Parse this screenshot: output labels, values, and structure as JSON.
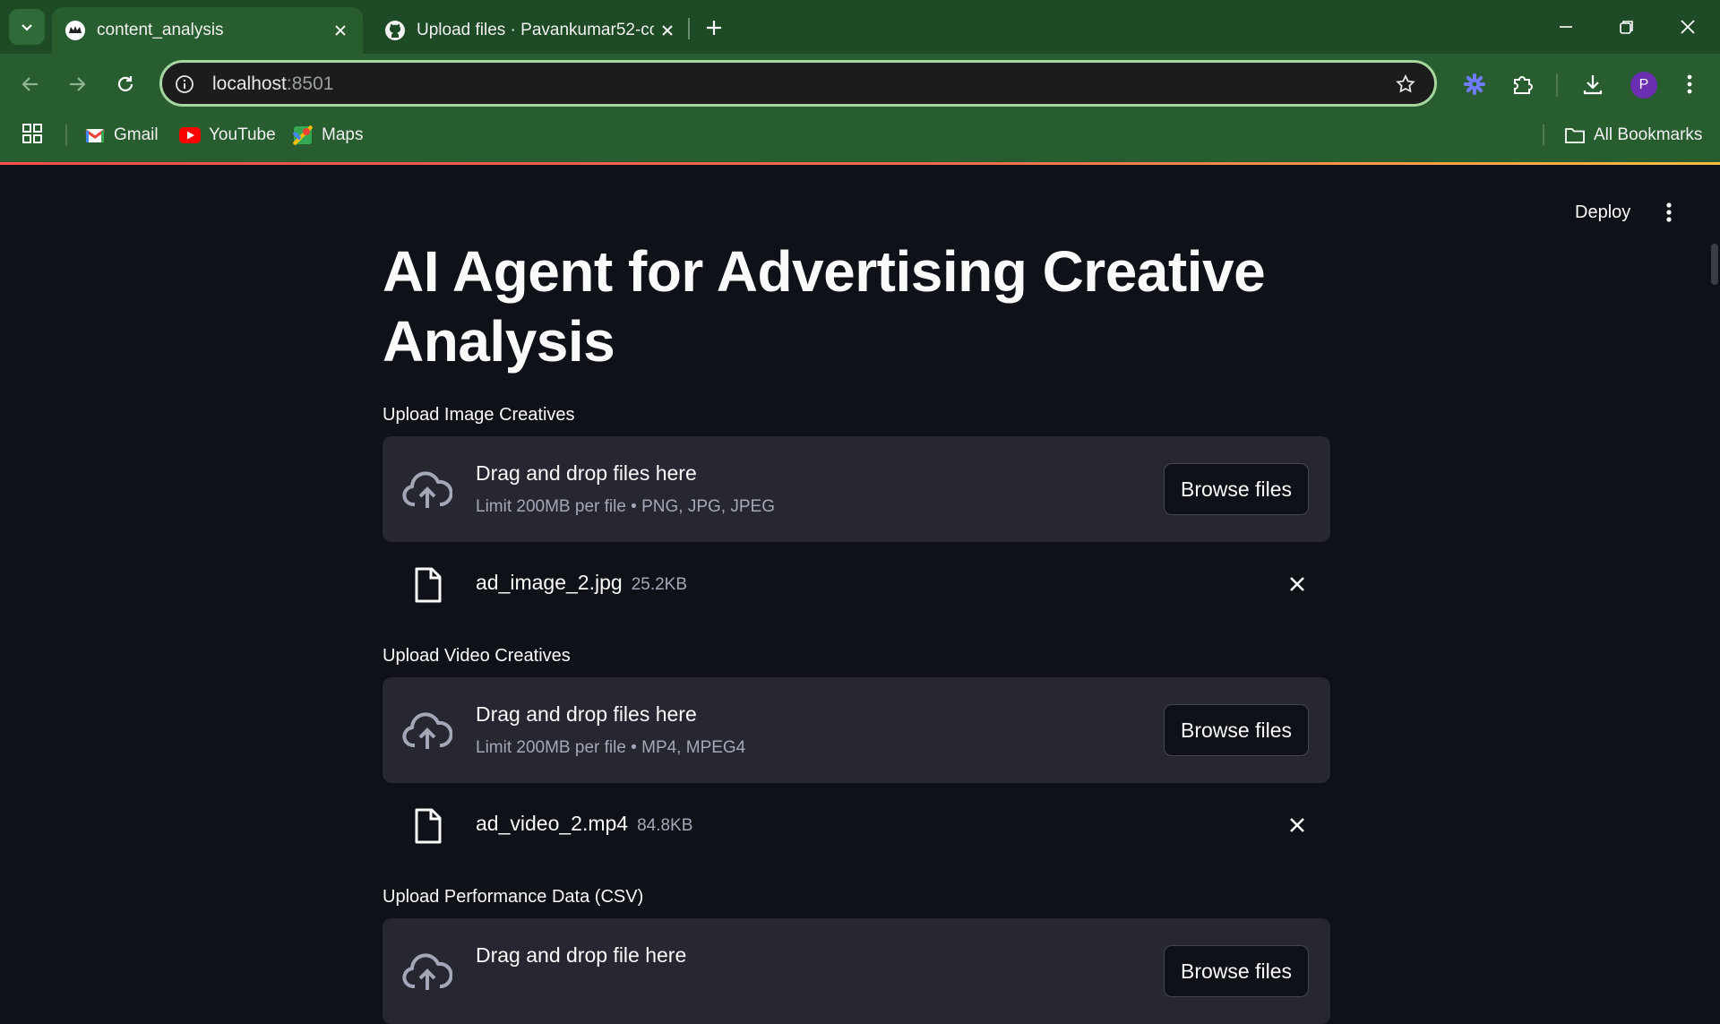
{
  "browser": {
    "tabs": [
      {
        "title": "content_analysis",
        "icon": "streamlit-crown-icon",
        "active": true
      },
      {
        "title": "Upload files · Pavankumar52-co",
        "icon": "github-icon",
        "active": false
      }
    ],
    "url_host": "localhost",
    "url_port": ":8501",
    "profile_initial": "P",
    "bookmarks": [
      {
        "label": "Gmail",
        "icon": "gmail-icon"
      },
      {
        "label": "YouTube",
        "icon": "youtube-icon"
      },
      {
        "label": "Maps",
        "icon": "maps-icon"
      }
    ],
    "all_bookmarks_label": "All Bookmarks"
  },
  "app": {
    "deploy_label": "Deploy",
    "title": "AI Agent for Advertising Creative Analysis",
    "sections": [
      {
        "label": "Upload Image Creatives",
        "drop_text": "Drag and drop files here",
        "limit_text": "Limit 200MB per file • PNG, JPG, JPEG",
        "browse_label": "Browse files",
        "file": {
          "name": "ad_image_2.jpg",
          "size": "25.2KB"
        }
      },
      {
        "label": "Upload Video Creatives",
        "drop_text": "Drag and drop files here",
        "limit_text": "Limit 200MB per file • MP4, MPEG4",
        "browse_label": "Browse files",
        "file": {
          "name": "ad_video_2.mp4",
          "size": "84.8KB"
        }
      },
      {
        "label": "Upload Performance Data (CSV)",
        "drop_text": "Drag and drop file here",
        "browse_label": "Browse files"
      }
    ]
  },
  "colors": {
    "app_bg": "#0e1117",
    "dropzone_bg": "#262730",
    "chrome_green": "#275d2f",
    "accent_gradient_start": "#ff4b4b",
    "accent_gradient_end": "#ffbd45"
  }
}
